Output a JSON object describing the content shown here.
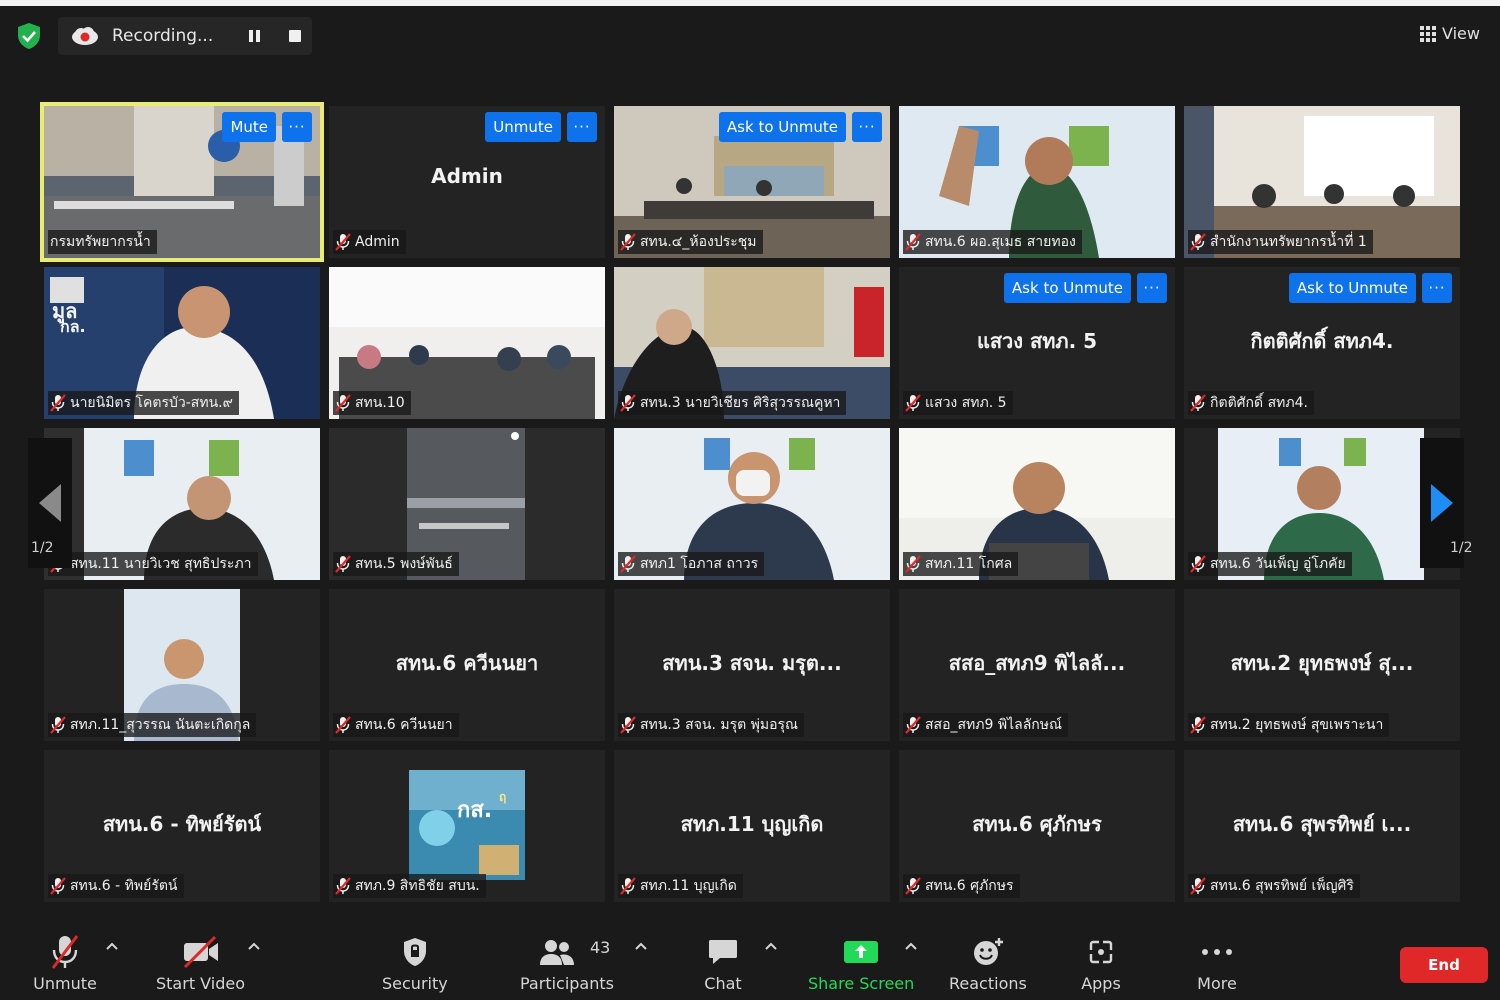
{
  "top": {
    "recording_label": "Recording...",
    "view_label": "View"
  },
  "tiles": [
    {
      "name": "กรมทรัพยากรน้ำ",
      "buttons": [
        "Mute",
        "···"
      ],
      "big": "",
      "video": true,
      "active": true
    },
    {
      "name": "Admin",
      "buttons": [
        "Unmute",
        "···"
      ],
      "big": "Admin",
      "video": false
    },
    {
      "name": "สทน.๔_ห้องประชุม",
      "buttons": [
        "Ask to Unmute",
        "···"
      ],
      "big": "",
      "video": true
    },
    {
      "name": "สทน.6 ผอ.สุเมธ สายทอง",
      "buttons": [],
      "big": "",
      "video": true
    },
    {
      "name": "สำนักงานทรัพยากรน้ำที่ 1",
      "buttons": [],
      "big": "",
      "video": true
    },
    {
      "name": "นายนิมิตร โคตรบัว-สทน.๙",
      "buttons": [],
      "big": "",
      "video": true
    },
    {
      "name": "สทน.10",
      "buttons": [],
      "big": "",
      "video": true
    },
    {
      "name": "สทน.3 นายวิเชียร ศิริสุวรรณคูหา",
      "buttons": [],
      "big": "",
      "video": true
    },
    {
      "name": "แสวง สทภ. 5",
      "buttons": [
        "Ask to Unmute",
        "···"
      ],
      "big": "แสวง สทภ. 5",
      "video": false
    },
    {
      "name": "กิตติศักดิ์ สทภ4.",
      "buttons": [
        "Ask to Unmute",
        "···"
      ],
      "big": "กิตติศักดิ์ สทภ4.",
      "video": false
    },
    {
      "name": "สทน.11 นายวิเวช สุทธิประภา",
      "buttons": [],
      "big": "",
      "video": true
    },
    {
      "name": "สทน.5 พงษ์พันธ์",
      "buttons": [],
      "big": "",
      "video": true
    },
    {
      "name": "สทภ1 โอภาส ถาวร",
      "buttons": [],
      "big": "",
      "video": true
    },
    {
      "name": "สทภ.11 โกศล",
      "buttons": [],
      "big": "",
      "video": true
    },
    {
      "name": "สทน.6 วันเพ็ญ อู่โภคัย",
      "buttons": [],
      "big": "",
      "video": true
    },
    {
      "name": "สทภ.11_สุวรรณ นันตะเกิดกุล",
      "buttons": [],
      "big": "",
      "video": true
    },
    {
      "name": "สทน.6 ควีนนยา",
      "buttons": [],
      "big": "สทน.6 ควีนนยา",
      "video": false
    },
    {
      "name": "สทน.3 สจน. มรุต พุ่มอรุณ",
      "buttons": [],
      "big": "สทน.3 สจน. มรุต...",
      "video": false
    },
    {
      "name": "สสอ_สทภ9 พิไลลักษณ์",
      "buttons": [],
      "big": "สสอ_สทภ9 พิไลลั...",
      "video": false
    },
    {
      "name": "สทน.2 ยุทธพงษ์ สุขเพราะนา",
      "buttons": [],
      "big": "สทน.2 ยุทธพงษ์ สุ...",
      "video": false
    },
    {
      "name": "สทน.6 - ทิพย์รัตน์",
      "buttons": [],
      "big": "สทน.6 - ทิพย์รัตน์",
      "video": false
    },
    {
      "name": "สทภ.9 สิทธิชัย สบน.",
      "buttons": [],
      "big": "",
      "video": true
    },
    {
      "name": "สทภ.11 บุญเกิด",
      "buttons": [],
      "big": "สทภ.11 บุญเกิด",
      "video": false
    },
    {
      "name": "สทน.6 ศุภักษร",
      "buttons": [],
      "big": "สทน.6 ศุภักษร",
      "video": false
    },
    {
      "name": "สทน.6 สุพรทิพย์ เพ็ญศิริ",
      "buttons": [],
      "big": "สทน.6 สุพรทิพย์ เ...",
      "video": false
    }
  ],
  "pager": {
    "left": "1/2",
    "right": "1/2"
  },
  "tile_overlays": {
    "poster_text_1": "มูล",
    "poster_text_2": "กล.",
    "poster_text_3": "กส.",
    "poster_text_4": "ฤ"
  },
  "toolbar": {
    "unmute": "Unmute",
    "start_video": "Start Video",
    "security": "Security",
    "participants": "Participants",
    "participants_count": "43",
    "chat": "Chat",
    "share_screen": "Share Screen",
    "reactions": "Reactions",
    "apps": "Apps",
    "more": "More",
    "end": "End"
  },
  "colors": {
    "accent_blue": "#0e72ed",
    "active_speaker": "#e8ec74",
    "share_green": "#23d959",
    "end_red": "#e02828",
    "muted_red": "#e02828"
  }
}
